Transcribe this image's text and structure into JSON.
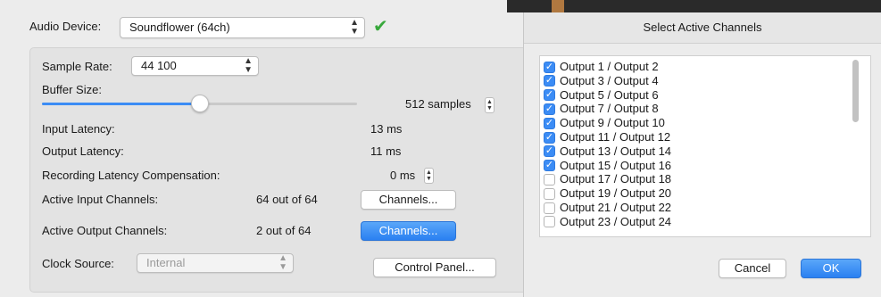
{
  "device": {
    "label": "Audio Device:",
    "value": "Soundflower (64ch)",
    "status_color": "#38a83b"
  },
  "settings": {
    "sample_rate_label": "Sample Rate:",
    "sample_rate_value": "44 100",
    "buffer_size_label": "Buffer Size:",
    "buffer_size_value": "512 samples",
    "buffer_slider_fraction": 0.5,
    "input_latency_label": "Input Latency:",
    "input_latency_value": "13 ms",
    "output_latency_label": "Output Latency:",
    "output_latency_value": "11 ms",
    "recording_comp_label": "Recording Latency Compensation:",
    "recording_comp_value": "0 ms",
    "active_input_label": "Active Input Channels:",
    "active_input_value": "64 out of 64",
    "active_input_button": "Channels...",
    "active_output_label": "Active Output Channels:",
    "active_output_value": "2 out of 64",
    "active_output_button": "Channels...",
    "clock_source_label": "Clock Source:",
    "clock_source_value": "Internal",
    "control_panel_button": "Control Panel..."
  },
  "dialog": {
    "title": "Select Active Channels",
    "channels": [
      {
        "label": "Output 1 / Output 2",
        "checked": true
      },
      {
        "label": "Output 3 / Output 4",
        "checked": true
      },
      {
        "label": "Output 5 / Output 6",
        "checked": true
      },
      {
        "label": "Output 7 / Output 8",
        "checked": true
      },
      {
        "label": "Output 9 / Output 10",
        "checked": true
      },
      {
        "label": "Output 11 / Output 12",
        "checked": true
      },
      {
        "label": "Output 13 / Output 14",
        "checked": true
      },
      {
        "label": "Output 15 / Output 16",
        "checked": true
      },
      {
        "label": "Output 17 / Output 18",
        "checked": false
      },
      {
        "label": "Output 19 / Output 20",
        "checked": false
      },
      {
        "label": "Output 21 / Output 22",
        "checked": false
      },
      {
        "label": "Output 23 / Output 24",
        "checked": false
      }
    ],
    "cancel_label": "Cancel",
    "ok_label": "OK"
  }
}
